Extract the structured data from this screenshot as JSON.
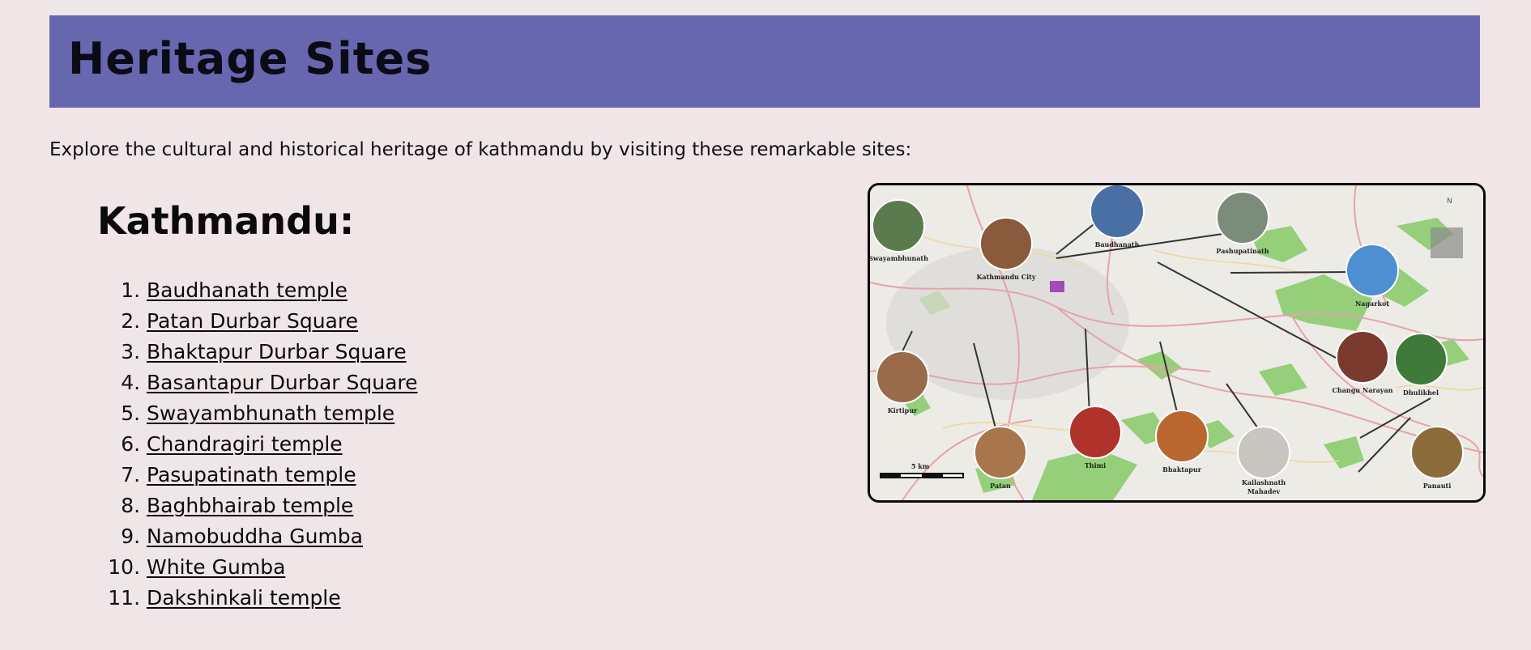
{
  "header": {
    "title": "Heritage Sites"
  },
  "intro": {
    "text": "Explore the cultural and historical heritage of kathmandu by visiting these remarkable sites:"
  },
  "section": {
    "title": "Kathmandu:"
  },
  "sites": [
    {
      "label": "Baudhanath temple"
    },
    {
      "label": "Patan Durbar Square"
    },
    {
      "label": "Bhaktapur Durbar Square"
    },
    {
      "label": "Basantapur Durbar Square"
    },
    {
      "label": "Swayambhunath temple"
    },
    {
      "label": "Chandragiri temple"
    },
    {
      "label": "Pasupatinath temple"
    },
    {
      "label": "Baghbhairab temple"
    },
    {
      "label": "Namobuddha Gumba"
    },
    {
      "label": "White Gumba"
    },
    {
      "label": "Dakshinkali temple"
    }
  ],
  "map": {
    "labels": {
      "swayambhunath": "Swayambhunath",
      "kathmandu_city": "Kathmandu City",
      "baudhanath": "Baudhanath",
      "pashupatinath": "Pashupatinath",
      "nagarkot": "Nagarkot",
      "kirtipur": "Kirtipur",
      "changu_narayan": "Changu Narayan",
      "dhulikhel": "Dhulikhel",
      "patan": "Patan",
      "thimi": "Thimi",
      "bhaktapur": "Bhaktapur",
      "kailashnath": "Kailashnath",
      "mahadev": "Mahadev",
      "panauti": "Panauti",
      "scale": "5 km"
    },
    "colors": {
      "green": "#8ccc6e",
      "road": "#e5a3a8",
      "road_yellow": "#efd79a",
      "border": "#0b0b0b"
    }
  }
}
